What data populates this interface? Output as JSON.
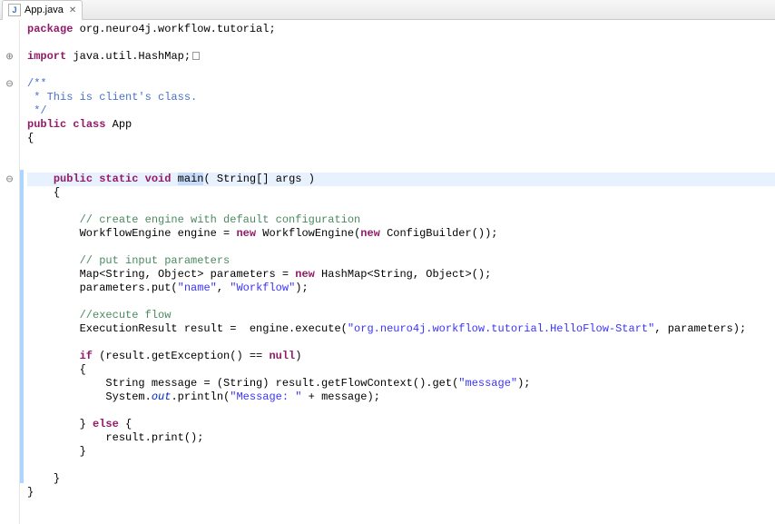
{
  "tab": {
    "filename": "App.java"
  },
  "code": {
    "package_kw": "package",
    "package_name": " org.neuro4j.workflow.tutorial;",
    "import_kw": "import",
    "import_name": " java.util.HashMap;",
    "jdoc_open": "/**",
    "jdoc_line": " * This is client's class.",
    "jdoc_close": " */",
    "public_kw": "public",
    "class_kw": "class",
    "class_name": " App",
    "brace_open": "{",
    "brace_close": "}",
    "static_kw": "static",
    "void_kw": "void",
    "main_name": "main",
    "main_args": "( String[] args )",
    "c_engine": "// create engine with default configuration",
    "l_engine_1": "WorkflowEngine engine = ",
    "new_kw": "new",
    "l_engine_2": " WorkflowEngine(",
    "l_engine_3": " ConfigBuilder());",
    "c_params": "// put input parameters",
    "l_map_1": "Map<String, Object> parameters = ",
    "l_map_2": " HashMap<String, Object>();",
    "l_put_1": "parameters.put(",
    "s_name": "\"name\"",
    "l_put_comma": ", ",
    "s_workflow": "\"Workflow\"",
    "l_put_end": ");",
    "c_exec": "//execute flow",
    "l_exec_1": "ExecutionResult result =  engine.execute(",
    "s_flow": "\"org.neuro4j.workflow.tutorial.HelloFlow-Start\"",
    "l_exec_2": ", parameters);",
    "if_kw": "if",
    "l_if_cond": " (result.getException() == ",
    "null_kw": "null",
    "l_if_end": ")",
    "l_msg_1": "String message = (String) result.getFlowContext().get(",
    "s_message": "\"message\"",
    "l_msg_end": ");",
    "l_sys_1": "System.",
    "out_field": "out",
    "l_sys_2": ".println(",
    "s_msgprefix": "\"Message: \"",
    "l_sys_3": " + message);",
    "else_kw": "else",
    "l_else": " {",
    "l_print": "result.print();",
    "indent1": "    ",
    "indent2": "        ",
    "indent3": "            "
  }
}
